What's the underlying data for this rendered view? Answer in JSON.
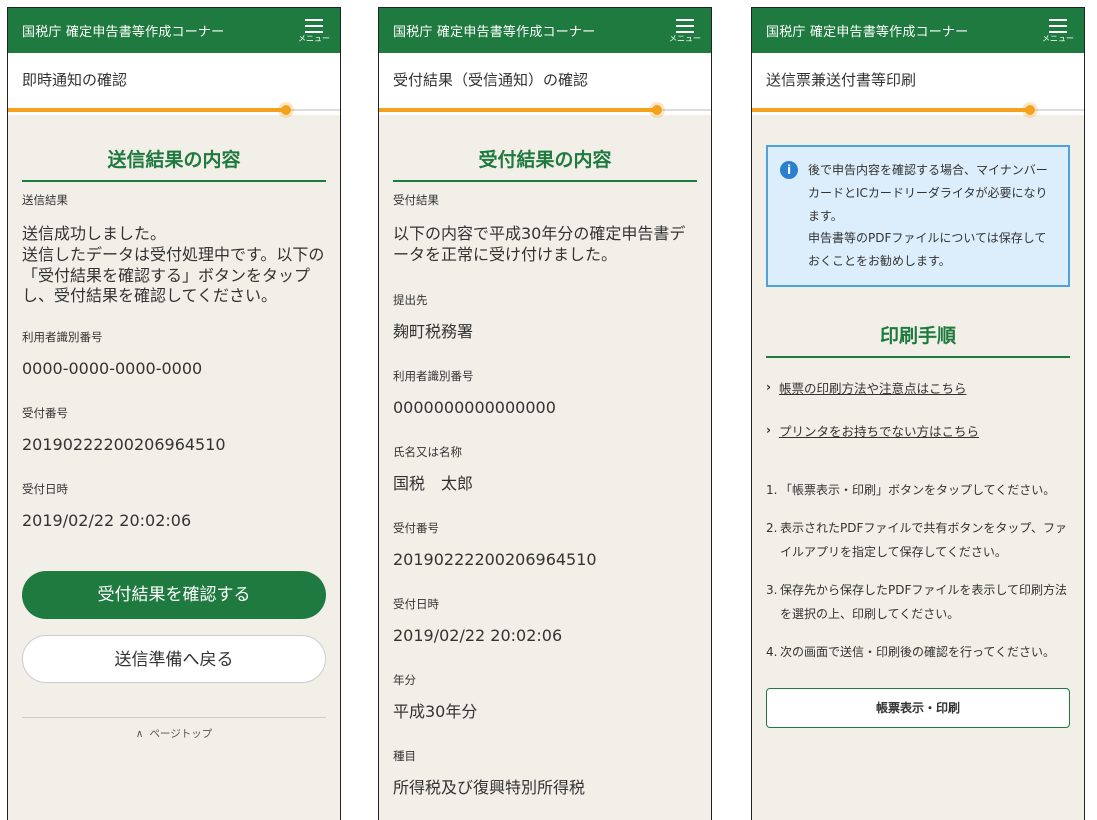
{
  "common": {
    "app_title": "国税庁 確定申告書等作成コーナー",
    "menu_label": "メニュー"
  },
  "screen1": {
    "page_heading": "即時通知の確認",
    "section_title": "送信結果の内容",
    "result_label": "送信結果",
    "result_text": "送信成功しました。\n送信したデータは受付処理中です。以下の「受付結果を確認する」ボタンをタップし、受付結果を確認してください。",
    "user_id_label": "利用者識別番号",
    "user_id_value": "0000-0000-0000-0000",
    "receipt_no_label": "受付番号",
    "receipt_no_value": "20190222200206964510",
    "receipt_time_label": "受付日時",
    "receipt_time_value": "2019/02/22 20:02:06",
    "primary_button": "受付結果を確認する",
    "secondary_button": "送信準備へ戻る",
    "page_top": "ページトップ"
  },
  "screen2": {
    "page_heading": "受付結果（受信通知）の確認",
    "section_title": "受付結果の内容",
    "result_label": "受付結果",
    "result_text": "以下の内容で平成30年分の確定申告書データを正常に受け付けました。",
    "submit_to_label": "提出先",
    "submit_to_value": "麹町税務署",
    "user_id_label": "利用者識別番号",
    "user_id_value": "0000000000000000",
    "name_label": "氏名又は名称",
    "name_value": "国税　太郎",
    "receipt_no_label": "受付番号",
    "receipt_no_value": "20190222200206964510",
    "receipt_time_label": "受付日時",
    "receipt_time_value": "2019/02/22 20:02:06",
    "year_label": "年分",
    "year_value": "平成30年分",
    "item_label": "種目",
    "item_value": "所得税及び復興特別所得税"
  },
  "screen3": {
    "page_heading": "送信票兼送付書等印刷",
    "info_line1": "後で申告内容を確認する場合、マイナンバーカードとICカードリーダライタが必要になります。",
    "info_line2": "申告書等のPDFファイルについては保存しておくことをお勧めします。",
    "section_title": "印刷手順",
    "link1": "帳票の印刷方法や注意点はこちら",
    "link2": "プリンタをお持ちでない方はこちら",
    "steps": [
      {
        "num": "1.",
        "text": "「帳票表示・印刷」ボタンをタップしてください。"
      },
      {
        "num": "2.",
        "text": "表示されたPDFファイルで共有ボタンをタップ、ファイルアプリを指定して保存してください。"
      },
      {
        "num": "3.",
        "text": "保存先から保存したPDFファイルを表示して印刷方法を選択の上、印刷してください。"
      },
      {
        "num": "4.",
        "text": "次の画面で送信・印刷後の確認を行ってください。"
      }
    ],
    "print_button": "帳票表示・印刷"
  },
  "colors": {
    "brand_green": "#1f7a3f",
    "progress_orange": "#f4a21d",
    "info_blue": "#4aa3e0",
    "background": "#f1efe7"
  }
}
